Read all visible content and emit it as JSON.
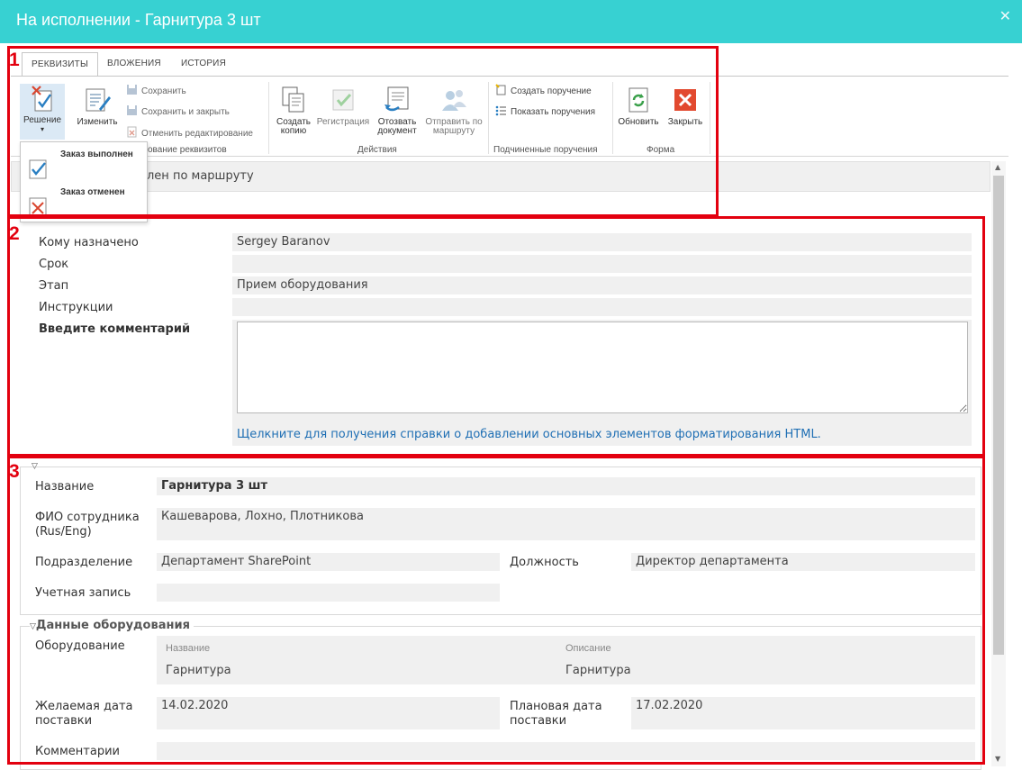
{
  "window": {
    "title": "На исполнении - Гарнитура 3 шт",
    "close_glyph": "✕"
  },
  "tabs": [
    {
      "label": "РЕКВИЗИТЫ",
      "active": true
    },
    {
      "label": "ВЛОЖЕНИЯ",
      "active": false
    },
    {
      "label": "ИСТОРИЯ",
      "active": false
    }
  ],
  "ribbon": {
    "decision_label": "Решение",
    "edit_label": "Изменить",
    "save_label": "Сохранить",
    "save_close_label": "Сохранить и закрыть",
    "cancel_edit_label": "Отменить редактирование",
    "group_edit_label": "ование реквизитов",
    "create_copy_label": "Создать\nкопию",
    "registration_label": "Регистрация",
    "recall_label": "Отозвать\nдокумент",
    "send_route_label": "Отправить по\nмаршруту",
    "group_actions_label": "Действия",
    "create_task_label": "Создать поручение",
    "show_tasks_label": "Показать поручения",
    "group_subtasks_label": "Подчиненные поручения",
    "refresh_label": "Обновить",
    "close_label": "Закрыть",
    "group_form_label": "Форма"
  },
  "dropdown": {
    "items": [
      "Заказ выполнен",
      "Заказ отменен"
    ]
  },
  "status": {
    "text": "лен по маршруту"
  },
  "task": {
    "assigned_label": "Кому назначено",
    "assigned_value": "Sergey Baranov",
    "due_label": "Срок",
    "due_value": "",
    "stage_label": "Этап",
    "stage_value": "Прием оборудования",
    "instructions_label": "Инструкции",
    "instructions_value": "",
    "comment_label": "Введите комментарий",
    "comment_value": "",
    "help_link": "Щелкните для получения справки о добавлении основных элементов форматирования HTML."
  },
  "details": {
    "name_label": "Название",
    "name_value": "Гарнитура 3 шт",
    "employees_label": "ФИО сотрудника\n(Rus/Eng)",
    "employees_value": "Кашеварова, Лохно, Плотникова",
    "department_label": "Подразделение",
    "department_value": "Департамент SharePoint",
    "position_label": "Должность",
    "position_value": "Директор департамента",
    "account_label": "Учетная запись",
    "account_value": ""
  },
  "equipment": {
    "section_title": "Данные оборудования",
    "equipment_label": "Оборудование",
    "col_name": "Название",
    "col_desc": "Описание",
    "row_name": "Гарнитура",
    "row_desc": "Гарнитура",
    "desired_date_label": "Желаемая дата\nпоставки",
    "desired_date_value": "14.02.2020",
    "planned_date_label": "Плановая дата\nпоставки",
    "planned_date_value": "17.02.2020",
    "comments_label": "Комментарии",
    "comments_value": ""
  },
  "annotations": [
    "1",
    "2",
    "3"
  ],
  "colors": {
    "titlebar": "#37d1d2",
    "annotation": "#e3000f",
    "link": "#1f6fb4"
  }
}
